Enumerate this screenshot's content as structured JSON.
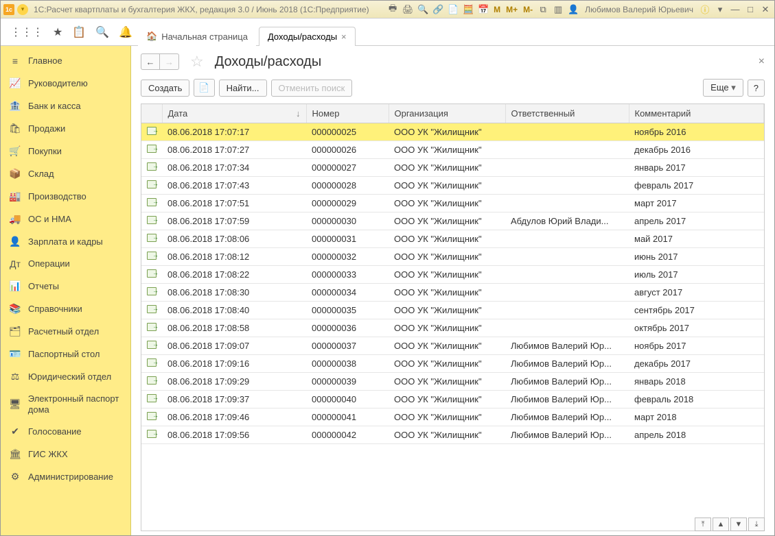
{
  "titlebar": {
    "title": "1С:Расчет квартплаты и бухгалтерия ЖКХ, редакция 3.0 / Июнь 2018  (1С:Предприятие)",
    "memory_buttons": [
      "M",
      "M+",
      "M-"
    ],
    "user": "Любимов Валерий Юрьевич"
  },
  "tabs": {
    "home": "Начальная страница",
    "active": "Доходы/расходы"
  },
  "sidebar": {
    "items": [
      {
        "icon": "≡",
        "label": "Главное"
      },
      {
        "icon": "📈",
        "label": "Руководителю"
      },
      {
        "icon": "🏦",
        "label": "Банк и касса"
      },
      {
        "icon": "🛍",
        "label": "Продажи"
      },
      {
        "icon": "🛒",
        "label": "Покупки"
      },
      {
        "icon": "📦",
        "label": "Склад"
      },
      {
        "icon": "🏭",
        "label": "Производство"
      },
      {
        "icon": "🚚",
        "label": "ОС и НМА"
      },
      {
        "icon": "👤",
        "label": "Зарплата и кадры"
      },
      {
        "icon": "Дт",
        "label": "Операции"
      },
      {
        "icon": "📊",
        "label": "Отчеты"
      },
      {
        "icon": "📚",
        "label": "Справочники"
      },
      {
        "icon": "🗂",
        "label": "Расчетный отдел"
      },
      {
        "icon": "🪪",
        "label": "Паспортный стол"
      },
      {
        "icon": "⚖",
        "label": "Юридический отдел"
      },
      {
        "icon": "🖥",
        "label": "Электронный паспорт дома"
      },
      {
        "icon": "✔",
        "label": "Голосование"
      },
      {
        "icon": "🏛",
        "label": "ГИС ЖКХ"
      },
      {
        "icon": "⚙",
        "label": "Администрирование"
      }
    ]
  },
  "page": {
    "title": "Доходы/расходы"
  },
  "toolbar": {
    "create": "Создать",
    "find": "Найти...",
    "cancel_search": "Отменить поиск",
    "more": "Еще",
    "help": "?"
  },
  "columns": {
    "date": "Дата",
    "number": "Номер",
    "organization": "Организация",
    "responsible": "Ответственный",
    "comment": "Комментарий"
  },
  "rows": [
    {
      "date": "08.06.2018 17:07:17",
      "number": "000000025",
      "organization": "ООО УК \"Жилищник\"",
      "responsible": "",
      "comment": "ноябрь 2016"
    },
    {
      "date": "08.06.2018 17:07:27",
      "number": "000000026",
      "organization": "ООО УК \"Жилищник\"",
      "responsible": "",
      "comment": "декабрь 2016"
    },
    {
      "date": "08.06.2018 17:07:34",
      "number": "000000027",
      "organization": "ООО УК \"Жилищник\"",
      "responsible": "",
      "comment": "январь 2017"
    },
    {
      "date": "08.06.2018 17:07:43",
      "number": "000000028",
      "organization": "ООО УК \"Жилищник\"",
      "responsible": "",
      "comment": "февраль 2017"
    },
    {
      "date": "08.06.2018 17:07:51",
      "number": "000000029",
      "organization": "ООО УК \"Жилищник\"",
      "responsible": "",
      "comment": "март 2017"
    },
    {
      "date": "08.06.2018 17:07:59",
      "number": "000000030",
      "organization": "ООО УК \"Жилищник\"",
      "responsible": "Абдулов Юрий Влади...",
      "comment": "апрель 2017"
    },
    {
      "date": "08.06.2018 17:08:06",
      "number": "000000031",
      "organization": "ООО УК \"Жилищник\"",
      "responsible": "",
      "comment": "май 2017"
    },
    {
      "date": "08.06.2018 17:08:12",
      "number": "000000032",
      "organization": "ООО УК \"Жилищник\"",
      "responsible": "",
      "comment": "июнь 2017"
    },
    {
      "date": "08.06.2018 17:08:22",
      "number": "000000033",
      "organization": "ООО УК \"Жилищник\"",
      "responsible": "",
      "comment": "июль 2017"
    },
    {
      "date": "08.06.2018 17:08:30",
      "number": "000000034",
      "organization": "ООО УК \"Жилищник\"",
      "responsible": "",
      "comment": "август 2017"
    },
    {
      "date": "08.06.2018 17:08:40",
      "number": "000000035",
      "organization": "ООО УК \"Жилищник\"",
      "responsible": "",
      "comment": "сентябрь 2017"
    },
    {
      "date": "08.06.2018 17:08:58",
      "number": "000000036",
      "organization": "ООО УК \"Жилищник\"",
      "responsible": "",
      "comment": "октябрь 2017"
    },
    {
      "date": "08.06.2018 17:09:07",
      "number": "000000037",
      "organization": "ООО УК \"Жилищник\"",
      "responsible": "Любимов Валерий Юр...",
      "comment": "ноябрь 2017"
    },
    {
      "date": "08.06.2018 17:09:16",
      "number": "000000038",
      "organization": "ООО УК \"Жилищник\"",
      "responsible": "Любимов Валерий Юр...",
      "comment": "декабрь 2017"
    },
    {
      "date": "08.06.2018 17:09:29",
      "number": "000000039",
      "organization": "ООО УК \"Жилищник\"",
      "responsible": "Любимов Валерий Юр...",
      "comment": "январь 2018"
    },
    {
      "date": "08.06.2018 17:09:37",
      "number": "000000040",
      "organization": "ООО УК \"Жилищник\"",
      "responsible": "Любимов Валерий Юр...",
      "comment": "февраль 2018"
    },
    {
      "date": "08.06.2018 17:09:46",
      "number": "000000041",
      "organization": "ООО УК \"Жилищник\"",
      "responsible": "Любимов Валерий Юр...",
      "comment": "март 2018"
    },
    {
      "date": "08.06.2018 17:09:56",
      "number": "000000042",
      "organization": "ООО УК \"Жилищник\"",
      "responsible": "Любимов Валерий Юр...",
      "comment": "апрель 2018"
    }
  ]
}
